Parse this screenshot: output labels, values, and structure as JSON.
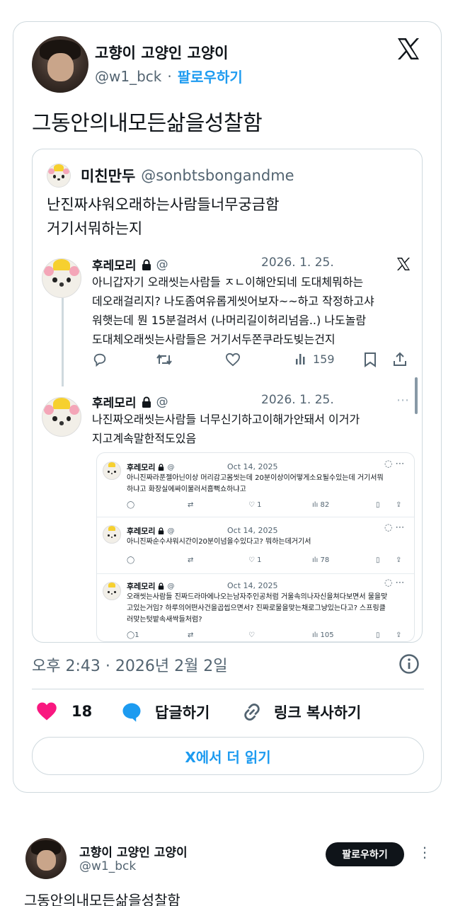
{
  "embed": {
    "author_name": "고향이 고양인 고양이",
    "author_handle": "@w1_bck",
    "separator": "·",
    "follow_label": "팔로우하기",
    "text": "그동안의내모든삶을성찰함",
    "timestamp": "오후 2:43 · 2026년 2월 2일",
    "likes": "18",
    "reply_label": "답글하기",
    "copy_link_label": "링크 복사하기",
    "read_more_label": "X에서 더 읽기"
  },
  "quote": {
    "author_name": "미친만두",
    "author_handle": "@sonbtsbongandme",
    "line1": "난진짜샤워오래하는사람들너무궁금함",
    "line2": "거기서뭐하는지"
  },
  "screenshot_tweets": [
    {
      "name": "후레모리",
      "at": "@",
      "date": "2026. 1. 25.",
      "lines": [
        "아니갑자기 오래씻는사람들 ㅈㄴ이해안되네 도대체뭐하는",
        "데오래걸리지? 나도좀여유롭게씻어보자~~하고 작정하고샤",
        "워햇는데 뭔 15분걸려서 (나머리길이허리넘음..) 나도놀람",
        "도대체오래씻는사람들은 거기서두쫀쿠라도빚는건지"
      ],
      "views": "159"
    },
    {
      "name": "후레모리",
      "at": "@",
      "date": "2026. 1. 25.",
      "lines": [
        "나진짜오래씻는사람들 너무신기하고이해가안돼서 이거가",
        "지고계속말한적도있음"
      ]
    }
  ],
  "nested_tweets": [
    {
      "name": "후레모리",
      "at": "@",
      "date": "Oct 14, 2025",
      "lines": [
        "아니진짜라푼젤아닌이상 머리감고몸씻는데 20분이상이어떻게소요될수있는데 거기서뭐",
        "하냐고 화장실에싸이불러서흠뻑쇼하냐고"
      ],
      "likes": "1",
      "views": "82"
    },
    {
      "name": "후레모리",
      "at": "@",
      "date": "Oct 14, 2025",
      "lines": [
        "아니진짜순수샤워시간이20분이넘을수있다고? 뭐하는데거기서"
      ],
      "likes": "1",
      "views": "78"
    },
    {
      "name": "후레모리",
      "at": "@",
      "date": "Oct 14, 2025",
      "lines": [
        "오래씻는사람들 진짜드라마에나오는남자주인공처럼 거울속의나자신을쳐다보면서 물을맞",
        "고있는거임? 하루의어떤사건을곱씹으면서? 진짜로물을맞는채로그냥있는다고? 스프링클",
        "러맞는텃밭속새싹들처럼?"
      ],
      "reply_count": "1",
      "views": "105"
    }
  ],
  "footer_post": {
    "author_name": "고향이 고양인 고양이",
    "author_handle": "@w1_bck",
    "follow_label": "팔로우하기",
    "more": "⋮",
    "text": "그동안의내모든삶을성찰함"
  },
  "colors": {
    "accent": "#1d9bf0",
    "heart": "#f91880",
    "border": "#cfd9de",
    "muted": "#536471"
  },
  "icons": [
    "x-logo-icon",
    "lock-icon",
    "reply-icon",
    "retweet-icon",
    "heart-icon",
    "views-icon",
    "bookmark-icon",
    "share-icon",
    "info-icon",
    "link-icon",
    "more-icon"
  ]
}
